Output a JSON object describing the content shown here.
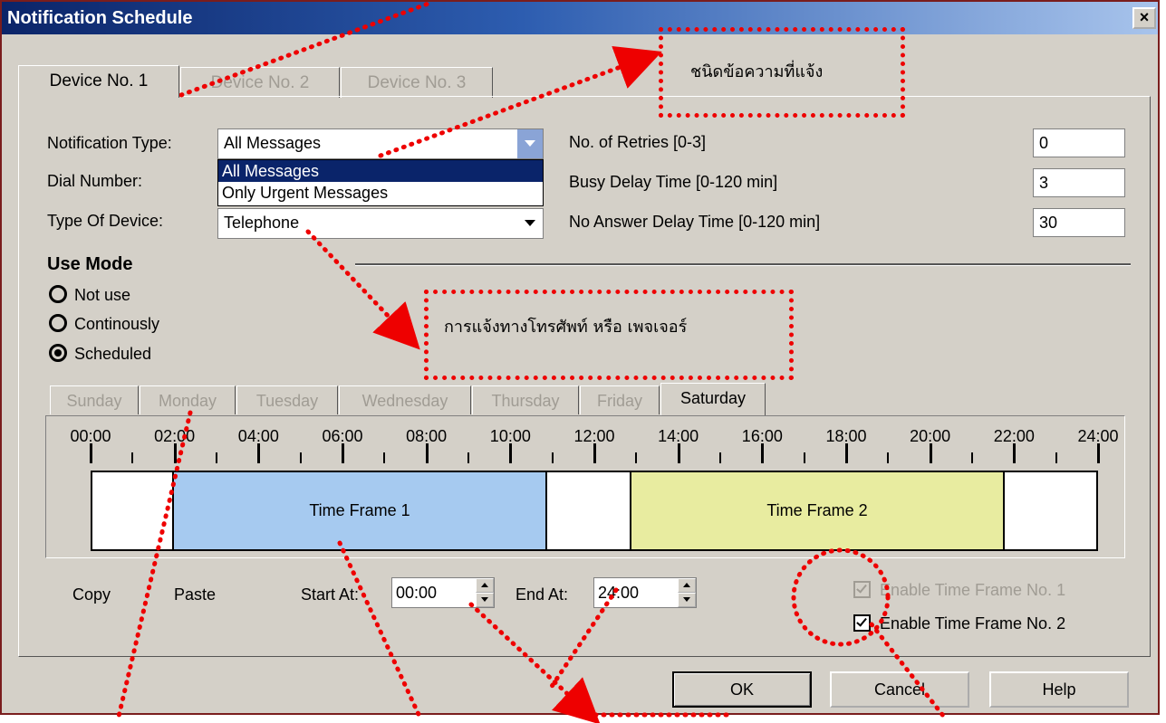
{
  "window": {
    "title": "Notification Schedule",
    "close_label": "×"
  },
  "device_tabs": [
    "Device No. 1",
    "Device No. 2",
    "Device No. 3"
  ],
  "notification_type": {
    "label": "Notification Type:",
    "value": "All Messages",
    "options": [
      "All Messages",
      "Only Urgent Messages"
    ]
  },
  "dial_number": {
    "label": "Dial Number:"
  },
  "type_of_device": {
    "label": "Type Of Device:",
    "value": "Telephone"
  },
  "retries": {
    "label": "No. of Retries [0-3]",
    "value": "0"
  },
  "busy_delay": {
    "label": "Busy Delay Time [0-120 min]",
    "value": "3"
  },
  "no_answer_delay": {
    "label": "No Answer Delay Time [0-120 min]",
    "value": "30"
  },
  "use_mode": {
    "heading": "Use Mode",
    "options": [
      "Not use",
      "Continously",
      "Scheduled"
    ],
    "selected": "Scheduled"
  },
  "day_tabs": [
    "Sunday",
    "Monday",
    "Tuesday",
    "Wednesday",
    "Thursday",
    "Friday",
    "Saturday"
  ],
  "active_day": "Saturday",
  "timeline": {
    "hours": [
      "00:00",
      "02:00",
      "04:00",
      "06:00",
      "08:00",
      "10:00",
      "12:00",
      "14:00",
      "16:00",
      "18:00",
      "20:00",
      "22:00",
      "24:00"
    ],
    "frames": [
      {
        "label": "Time Frame 1",
        "color": "#a6caf0"
      },
      {
        "label": "Time Frame 2",
        "color": "#e8eca0"
      }
    ]
  },
  "controls": {
    "copy": "Copy",
    "paste": "Paste",
    "start_label": "Start At:",
    "start_value": "00:00",
    "end_label": "End At:",
    "end_value": "24:00",
    "enable1": "Enable Time Frame No. 1",
    "enable2": "Enable Time Frame No. 2"
  },
  "buttons": {
    "ok": "OK",
    "cancel": "Cancel",
    "help": "Help"
  },
  "annotations": {
    "message_type": "ชนิดข้อความที่แจ้ง",
    "phone_pager": "การแจ้งทางโทรศัพท์ หรือ เพจเจอร์"
  },
  "colors": {
    "annotation": "#e00000",
    "title_start": "#0b2468",
    "selection": "#0a246a"
  }
}
